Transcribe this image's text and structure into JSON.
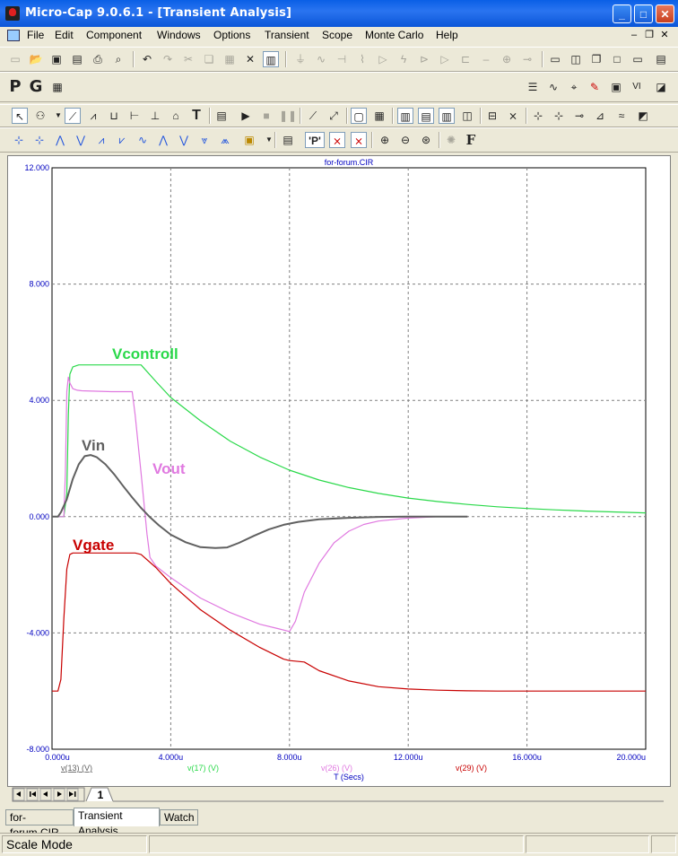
{
  "window": {
    "title": "Micro-Cap 9.0.6.1 - [Transient Analysis]"
  },
  "menu": [
    "File",
    "Edit",
    "Component",
    "Windows",
    "Options",
    "Transient",
    "Scope",
    "Monte Carlo",
    "Help"
  ],
  "toolbar_row2": {
    "p_label": "P",
    "g_label": "G"
  },
  "chart_data": {
    "type": "line",
    "title": "for-forum.CIR",
    "xlabel": "T (Secs)",
    "xlim": [
      0,
      20
    ],
    "ylim": [
      -8,
      12
    ],
    "x_unit_suffix": "u",
    "x_ticks": [
      "0.000u",
      "4.000u",
      "8.000u",
      "12.000u",
      "16.000u",
      "20.000u"
    ],
    "y_ticks": [
      "12.000",
      "8.000",
      "4.000",
      "0.000",
      "-4.000",
      "-8.000"
    ],
    "grid": true,
    "expression_labels": [
      "v(13) (V)",
      "v(17) (V)",
      "v(26) (V)",
      "v(29) (V)"
    ],
    "series": [
      {
        "name": "Vin",
        "expr": "v(13) (V)",
        "color": "#606060",
        "x": [
          0,
          0.1,
          0.2,
          0.3,
          0.5,
          0.7,
          0.9,
          1.1,
          1.3,
          1.5,
          1.8,
          2.1,
          2.4,
          2.7,
          3.0,
          3.3,
          3.6,
          4.0,
          4.5,
          5.0,
          5.5,
          5.9,
          6.3,
          6.8,
          7.3,
          7.8,
          8.3,
          9.0,
          10,
          11,
          12,
          13,
          14
        ],
        "y": [
          0,
          0,
          0,
          0.15,
          0.6,
          1.3,
          1.8,
          2.08,
          2.12,
          2.05,
          1.8,
          1.45,
          1.05,
          0.66,
          0.3,
          -0.02,
          -0.3,
          -0.62,
          -0.88,
          -1.05,
          -1.08,
          -1.06,
          -0.9,
          -0.66,
          -0.44,
          -0.28,
          -0.18,
          -0.09,
          -0.04,
          -0.01,
          0,
          0,
          0
        ]
      },
      {
        "name": "Vcontroll",
        "expr": "v(17) (V)",
        "color": "#2ad94a",
        "x": [
          0,
          0.2,
          0.4,
          0.5,
          0.55,
          0.6,
          0.7,
          0.9,
          1.2,
          2.0,
          2.6,
          2.9,
          3.0,
          3.5,
          4.0,
          5,
          6,
          7,
          8,
          9,
          10,
          11,
          12,
          13,
          14,
          15,
          16,
          17,
          18,
          19,
          20
        ],
        "y": [
          0,
          0,
          0,
          0.8,
          3.5,
          4.9,
          5.15,
          5.22,
          5.22,
          5.22,
          5.22,
          5.22,
          5.22,
          4.65,
          4.1,
          3.3,
          2.6,
          2.05,
          1.6,
          1.26,
          1.0,
          0.8,
          0.64,
          0.52,
          0.42,
          0.34,
          0.28,
          0.23,
          0.19,
          0.16,
          0.13
        ]
      },
      {
        "name": "Vout",
        "expr": "v(26) (V)",
        "color": "#e079e0",
        "x": [
          0,
          0.2,
          0.4,
          0.45,
          0.5,
          0.55,
          0.6,
          0.7,
          0.85,
          1.0,
          2.0,
          2.7,
          2.8,
          3.0,
          3.2,
          3.3,
          3.5,
          4.0,
          5,
          6,
          7,
          7.6,
          8.0,
          8.2,
          8.5,
          9.0,
          9.5,
          10.0,
          10.5,
          11,
          12,
          13,
          14
        ],
        "y": [
          0,
          0,
          0,
          1.5,
          4.3,
          4.8,
          4.6,
          4.4,
          4.35,
          4.33,
          4.3,
          4.3,
          3.5,
          1.5,
          -0.6,
          -1.4,
          -1.7,
          -2.1,
          -2.8,
          -3.3,
          -3.7,
          -3.85,
          -3.95,
          -3.6,
          -2.6,
          -1.6,
          -0.9,
          -0.5,
          -0.27,
          -0.15,
          -0.05,
          0,
          0
        ]
      },
      {
        "name": "Vgate",
        "expr": "v(29) (V)",
        "color": "#c80000",
        "x": [
          0,
          0.1,
          0.2,
          0.3,
          0.4,
          0.5,
          0.6,
          0.7,
          0.8,
          1.0,
          2.0,
          2.8,
          3.0,
          3.5,
          4.0,
          5,
          6,
          7,
          7.8,
          8.0,
          8.5,
          9,
          10,
          11,
          12,
          13,
          14,
          15,
          16,
          17,
          18,
          19,
          20
        ],
        "y": [
          -6,
          -6,
          -6,
          -5.6,
          -3.5,
          -1.8,
          -1.3,
          -1.25,
          -1.25,
          -1.25,
          -1.25,
          -1.25,
          -1.3,
          -1.75,
          -2.3,
          -3.2,
          -3.9,
          -4.5,
          -4.9,
          -4.95,
          -5.0,
          -5.3,
          -5.65,
          -5.85,
          -5.93,
          -5.97,
          -5.99,
          -6,
          -6,
          -6,
          -6,
          -6,
          -6
        ]
      }
    ],
    "annotations": [
      {
        "text": "Vcontroll",
        "color": "#2ad94a"
      },
      {
        "text": "Vin",
        "color": "#606060"
      },
      {
        "text": "Vout",
        "color": "#e079e0"
      },
      {
        "text": "Vgate",
        "color": "#c80000"
      }
    ]
  },
  "page_tab": "1",
  "bottom_tabs": [
    "for-forum.CIR",
    "Transient Analysis",
    "Watch"
  ],
  "status": {
    "mode": "Scale Mode"
  }
}
